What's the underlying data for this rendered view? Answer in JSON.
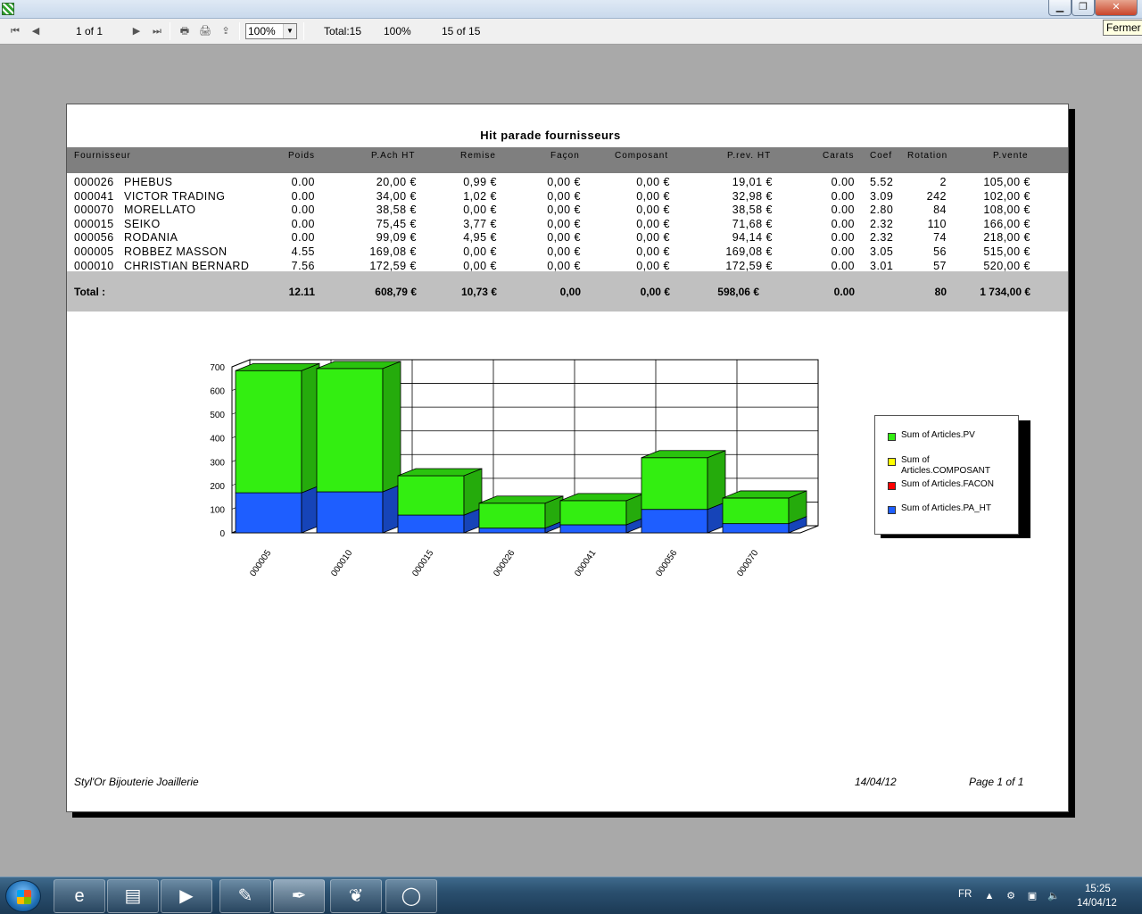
{
  "window": {
    "close_tooltip": "Fermer",
    "min_glyph": "▁",
    "max_glyph": "❐",
    "close_glyph": "✕"
  },
  "toolbar": {
    "page_indicator": "1 of 1",
    "zoom_value": "100%",
    "total": "Total:15",
    "percent": "100%",
    "records": "15 of 15",
    "icons": [
      "first-page-icon",
      "previous-page-icon",
      "next-page-icon",
      "last-page-icon",
      "print-icon",
      "printer-setup-icon",
      "export-icon",
      "dropdown-arrow-icon"
    ],
    "first_glyph": "⏮",
    "prev_glyph": "◀",
    "next_glyph": "▶",
    "last_glyph": "⏭",
    "print_glyph": "🖶",
    "setup_glyph": "🖨",
    "export_glyph": "⇪",
    "dropdown_glyph": "▼"
  },
  "report": {
    "title": "Hit parade fournisseurs",
    "columns": {
      "fournisseur": "Fournisseur",
      "poids": "Poids",
      "pach": "P.Ach HT",
      "remise": "Remise",
      "facon": "Façon",
      "composant": "Composant",
      "prev": "P.rev. HT",
      "carats": "Carats",
      "coef": "Coef",
      "rotation": "Rotation",
      "pvente": "P.vente"
    },
    "rows": [
      {
        "code": "000026",
        "name": "PHEBUS",
        "poids": "0.00",
        "pach": "20,00 €",
        "remise": "0,99 €",
        "facon": "0,00 €",
        "composant": "0,00 €",
        "prev": "19,01 €",
        "carats": "0.00",
        "coef": "5.52",
        "rotation": "2",
        "pvente": "105,00 €"
      },
      {
        "code": "000041",
        "name": "VICTOR TRADING",
        "poids": "0.00",
        "pach": "34,00 €",
        "remise": "1,02 €",
        "facon": "0,00 €",
        "composant": "0,00 €",
        "prev": "32,98 €",
        "carats": "0.00",
        "coef": "3.09",
        "rotation": "242",
        "pvente": "102,00 €"
      },
      {
        "code": "000070",
        "name": "MORELLATO",
        "poids": "0.00",
        "pach": "38,58 €",
        "remise": "0,00 €",
        "facon": "0,00 €",
        "composant": "0,00 €",
        "prev": "38,58 €",
        "carats": "0.00",
        "coef": "2.80",
        "rotation": "84",
        "pvente": "108,00 €"
      },
      {
        "code": "000015",
        "name": "SEIKO",
        "poids": "0.00",
        "pach": "75,45 €",
        "remise": "3,77 €",
        "facon": "0,00 €",
        "composant": "0,00 €",
        "prev": "71,68 €",
        "carats": "0.00",
        "coef": "2.32",
        "rotation": "110",
        "pvente": "166,00 €"
      },
      {
        "code": "000056",
        "name": "RODANIA",
        "poids": "0.00",
        "pach": "99,09 €",
        "remise": "4,95 €",
        "facon": "0,00 €",
        "composant": "0,00 €",
        "prev": "94,14 €",
        "carats": "0.00",
        "coef": "2.32",
        "rotation": "74",
        "pvente": "218,00 €"
      },
      {
        "code": "000005",
        "name": "ROBBEZ MASSON",
        "poids": "4.55",
        "pach": "169,08 €",
        "remise": "0,00 €",
        "facon": "0,00 €",
        "composant": "0,00 €",
        "prev": "169,08 €",
        "carats": "0.00",
        "coef": "3.05",
        "rotation": "56",
        "pvente": "515,00 €"
      },
      {
        "code": "000010",
        "name": "CHRISTIAN BERNARD",
        "poids": "7.56",
        "pach": "172,59 €",
        "remise": "0,00 €",
        "facon": "0,00 €",
        "composant": "0,00 €",
        "prev": "172,59 €",
        "carats": "0.00",
        "coef": "3.01",
        "rotation": "57",
        "pvente": "520,00 €"
      }
    ],
    "totals": {
      "label": "Total :",
      "poids": "12.11",
      "pach": "608,79 €",
      "remise": "10,73 €",
      "facon": "0,00",
      "composant": "0,00 €",
      "prev": "598,06 €",
      "carats": "0.00",
      "rotation": "80",
      "pvente": "1 734,00 €"
    },
    "footer": {
      "company": "Styl'Or Bijouterie Joaillerie",
      "date": "14/04/12",
      "page": "Page 1 of 1"
    }
  },
  "chart_data": {
    "type": "bar",
    "stacked": true,
    "three_d": true,
    "categories": [
      "000005",
      "000010",
      "000015",
      "000026",
      "000041",
      "000056",
      "000070"
    ],
    "series": [
      {
        "name": "Sum of Articles.PA_HT",
        "color": "#1e5eff",
        "values": [
          169,
          173,
          75,
          20,
          34,
          99,
          39
        ]
      },
      {
        "name": "Sum of Articles.FACON",
        "color": "#ff0000",
        "values": [
          0,
          0,
          0,
          0,
          0,
          0,
          0
        ]
      },
      {
        "name": "Sum of Articles.COMPOSANT",
        "color": "#ffff00",
        "values": [
          0,
          0,
          0,
          0,
          0,
          0,
          0
        ]
      },
      {
        "name": "Sum of Articles.PV",
        "color": "#33ee11",
        "values": [
          515,
          520,
          166,
          105,
          102,
          218,
          108
        ]
      }
    ],
    "legend_order": [
      "Sum of Articles.PV",
      "Sum of Articles.COMPOSANT",
      "Sum of Articles.FACON",
      "Sum of Articles.PA_HT"
    ],
    "y_ticks": [
      "0",
      "100",
      "200",
      "300",
      "400",
      "500",
      "600",
      "700"
    ],
    "ylim": [
      0,
      700
    ],
    "grid": true,
    "legend_position": "right"
  },
  "taskbar": {
    "language": "FR",
    "time": "15:25",
    "date": "14/04/12",
    "apps": [
      "internet-explorer-icon",
      "file-explorer-icon",
      "media-player-icon",
      "paint-icon",
      "quill-app-icon",
      "leaf-app-icon",
      "ring-app-icon"
    ],
    "app_glyphs": [
      "e",
      "▤",
      "▶",
      "✎",
      "✒",
      "❦",
      "◯"
    ],
    "tray_glyphs": {
      "flag": "▲",
      "tool": "⚙",
      "network": "▣",
      "volume": "🔈"
    }
  }
}
